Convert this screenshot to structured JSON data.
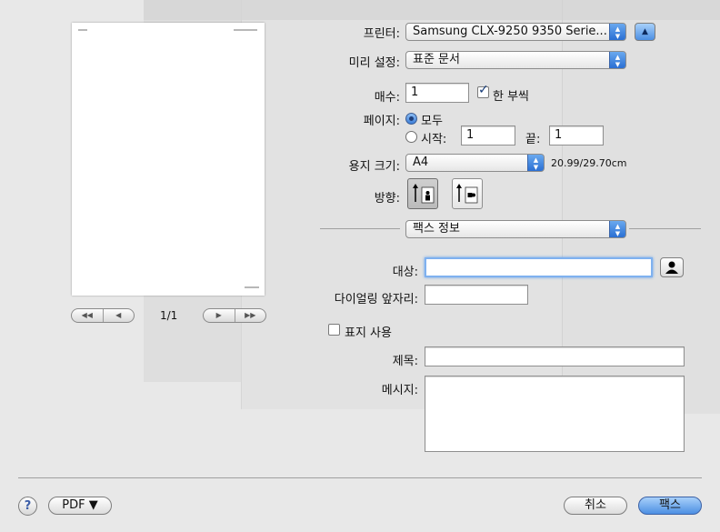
{
  "preview": {
    "page_indicator": "1/1"
  },
  "form": {
    "printer_label": "프린터:",
    "printer_value": "Samsung CLX-9250 9350 Serie...",
    "presets_label": "미리 설정:",
    "presets_value": "표준 문서",
    "copies_label": "매수:",
    "copies_value": "1",
    "collated_label": "한 부씩",
    "pages_label": "페이지:",
    "pages_all_label": "모두",
    "pages_from_label": "시작:",
    "pages_from_value": "1",
    "pages_to_label": "끝:",
    "pages_to_value": "1",
    "paper_size_label": "용지 크기:",
    "paper_size_value": "A4",
    "paper_dimensions": "20.99/29.70cm",
    "orientation_label": "방향:",
    "section_value": "팩스 정보"
  },
  "fax": {
    "to_label": "대상:",
    "to_value": "",
    "dial_prefix_label": "다이얼링 앞자리:",
    "dial_prefix_value": "",
    "cover_page_label": "표지 사용",
    "subject_label": "제목:",
    "subject_value": "",
    "message_label": "메시지:",
    "message_value": ""
  },
  "footer": {
    "help_label": "?",
    "pdf_label": "PDF ▼",
    "cancel_label": "취소",
    "fax_label": "팩스"
  }
}
